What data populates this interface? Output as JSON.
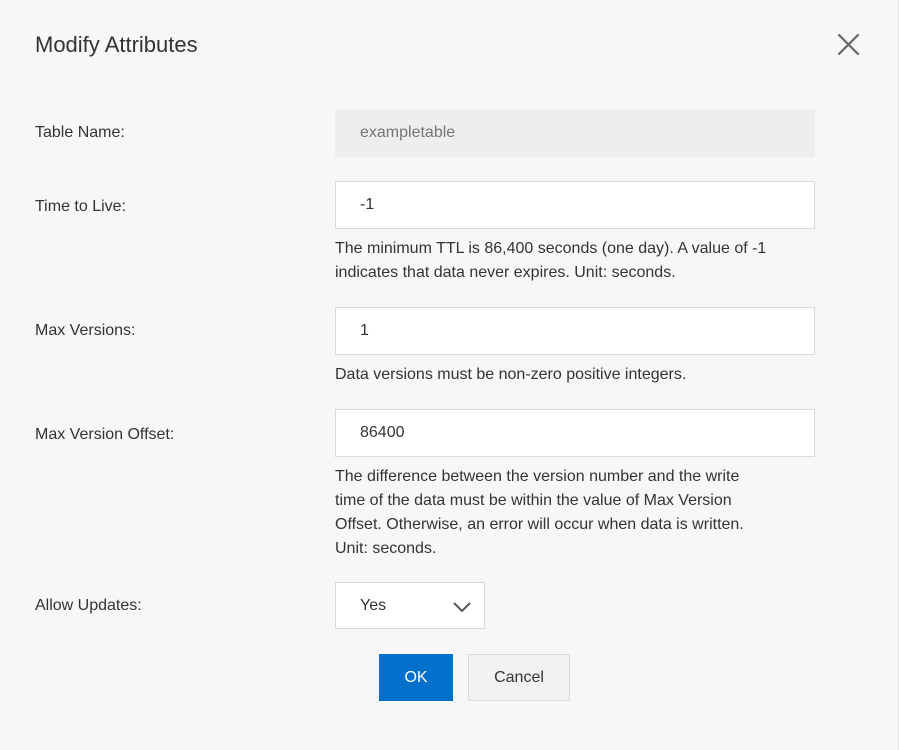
{
  "dialog": {
    "title": "Modify Attributes",
    "close_icon": "close-icon"
  },
  "form": {
    "table_name": {
      "label": "Table Name:",
      "value": "",
      "placeholder": "exampletable"
    },
    "ttl": {
      "label": "Time to Live:",
      "value": "-1",
      "help_line1": "The minimum TTL is 86,400 seconds (one day). A value of -1",
      "help_line2": "indicates that data never expires. Unit: seconds."
    },
    "max_versions": {
      "label": "Max Versions:",
      "value": "1",
      "help": "Data versions must be non-zero positive integers."
    },
    "max_version_offset": {
      "label": "Max Version Offset:",
      "value": "86400",
      "help_line1": "The difference between the version number and the write",
      "help_line2": "time of the data must be within the value of Max Version",
      "help_line3": "Offset. Otherwise, an error will occur when data is written.",
      "help_line4": "Unit: seconds."
    },
    "allow_updates": {
      "label": "Allow Updates:",
      "selected": "Yes",
      "chevron_icon": "chevron-down-icon"
    }
  },
  "actions": {
    "ok_label": "OK",
    "cancel_label": "Cancel"
  },
  "colors": {
    "primary": "#0070cc",
    "background": "#f7f7f7",
    "disabled_field": "#eeeeee",
    "border": "#d9d9d9"
  }
}
